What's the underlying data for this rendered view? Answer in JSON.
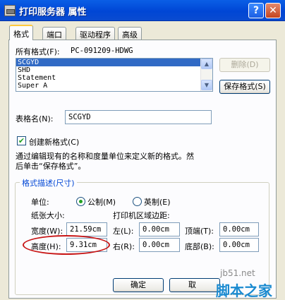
{
  "window": {
    "title": "打印服务器 属性",
    "help_label": "?",
    "close_label": "✕"
  },
  "tabs": [
    {
      "label": "格式",
      "active": true
    },
    {
      "label": "端口",
      "active": false
    },
    {
      "label": "驱动程序",
      "active": false
    },
    {
      "label": "高级",
      "active": false
    }
  ],
  "all_forms": {
    "label": "所有格式(F):",
    "server": "PC-091209-HDWG",
    "items": [
      "SCGYD",
      "SHD",
      "Statement",
      "Super A"
    ],
    "selected_index": 0
  },
  "buttons": {
    "delete": "删除(D)",
    "save": "保存格式(S)",
    "ok": "确定",
    "cancel": "取"
  },
  "form_name": {
    "label": "表格名(N):",
    "value": "SCGYD"
  },
  "create_new": {
    "label": "创建新格式(C)",
    "checked": true
  },
  "description": {
    "line1": "通过编辑现有的名称和度量单位来定义新的格式。然",
    "line2": "后单击“保存格式”。"
  },
  "group": {
    "title": "格式描述(尺寸)",
    "units_label": "单位:",
    "metric_label": "公制(M)",
    "english_label": "英制(E)",
    "metric_selected": true,
    "paper_size_label": "纸张大小:",
    "margins_label": "打印机区域边距:",
    "width_label": "宽度(W):",
    "width_value": "21.59cm",
    "height_label": "高度(H):",
    "height_value": "9.31cm",
    "left_label": "左(L):",
    "left_value": "0.00cm",
    "right_label": "右(R):",
    "right_value": "0.00cm",
    "top_label": "顶端(T):",
    "top_value": "0.00cm",
    "bottom_label": "底部(B):",
    "bottom_value": "0.00cm"
  },
  "watermark": {
    "site": "jb51.net",
    "brand": "脚本之家"
  }
}
